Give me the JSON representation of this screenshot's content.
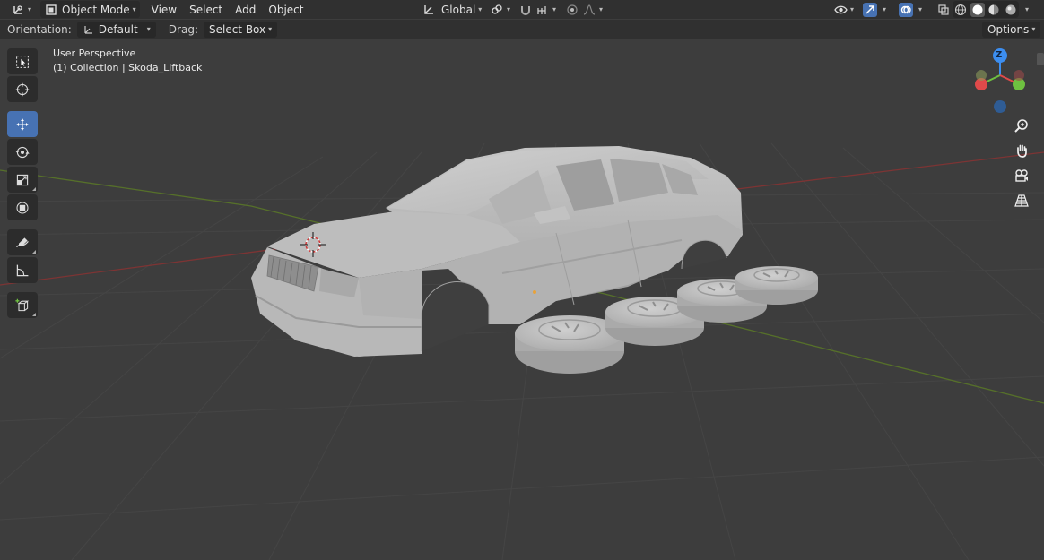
{
  "header": {
    "editor_type_icon": "axes-editor-icon",
    "mode": "Object Mode",
    "menus": [
      "View",
      "Select",
      "Add",
      "Object"
    ],
    "transform_orientation": "Global",
    "icons": {
      "pivot": "pivot-link-icon",
      "snap": "snap-magnet-icon",
      "snap_target": "snap-increment-icon",
      "proportional": "proportional-edit-icon",
      "falloff": "falloff-curve-icon",
      "visibility": "eye-visibility-icon",
      "gizmo": "gizmo-icon",
      "overlay": "overlay-icon",
      "xray": "xray-icon",
      "shading_wire": "wireframe-shading-icon",
      "shading_solid": "solid-shading-icon",
      "shading_material": "material-shading-icon",
      "shading_render": "render-shading-icon"
    }
  },
  "toolsettings": {
    "orientation_label": "Orientation:",
    "orientation_value": "Default",
    "drag_label": "Drag:",
    "drag_value": "Select Box",
    "options_label": "Options"
  },
  "viewport": {
    "perspective_label": "User Perspective",
    "collection_label": "(1) Collection | Skoda_Liftback",
    "gizmo_axis_label": "Z",
    "colors": {
      "background": "#3d3d3d",
      "grid": "#464646",
      "x_axis": "#8a3a3a",
      "y_axis": "#5d7a2a",
      "gizmo_x": "#e04a4a",
      "gizmo_y": "#6ec040",
      "gizmo_z": "#3c8ef0",
      "model": "#b8b8b8"
    }
  },
  "toolbar": {
    "tools": [
      {
        "name": "select-box-tool",
        "icon": "select-box-icon",
        "active": false
      },
      {
        "name": "cursor-tool",
        "icon": "cursor-icon",
        "active": false
      },
      {
        "name": "move-tool",
        "icon": "move-icon",
        "active": true
      },
      {
        "name": "rotate-tool",
        "icon": "rotate-icon",
        "active": false
      },
      {
        "name": "scale-tool",
        "icon": "scale-icon",
        "active": false
      },
      {
        "name": "transform-tool",
        "icon": "transform-icon",
        "active": false
      },
      {
        "name": "annotate-tool",
        "icon": "annotate-icon",
        "active": false
      },
      {
        "name": "measure-tool",
        "icon": "measure-icon",
        "active": false
      },
      {
        "name": "add-cube-tool",
        "icon": "add-cube-icon",
        "active": false
      }
    ]
  },
  "navigation": [
    "zoom-icon",
    "hand-pan-icon",
    "camera-icon",
    "perspective-grid-icon"
  ]
}
